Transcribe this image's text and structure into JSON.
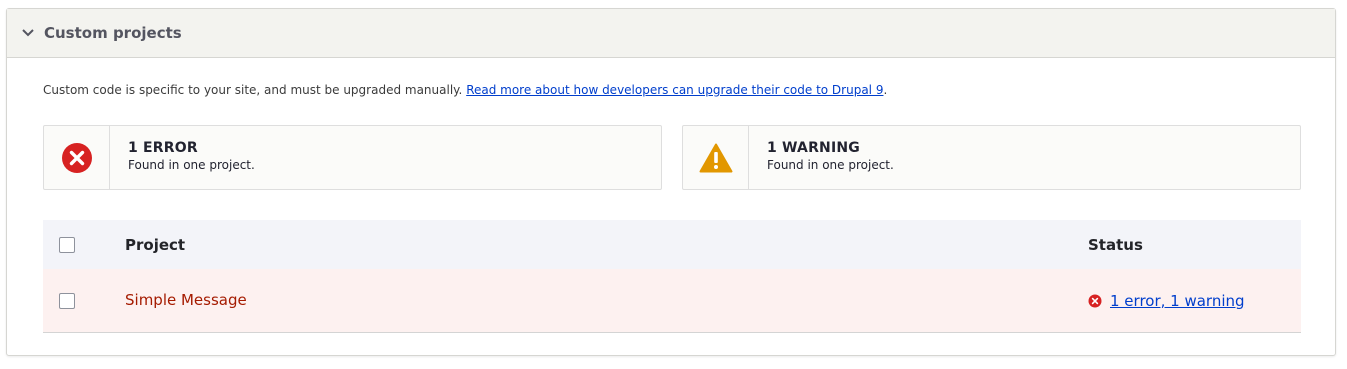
{
  "panel": {
    "title": "Custom projects"
  },
  "intro": {
    "text": "Custom code is specific to your site, and must be upgraded manually. ",
    "link_text": "Read more about how developers can upgrade their code to Drupal 9",
    "trailing": "."
  },
  "summary": {
    "error": {
      "icon": "error-circle-icon",
      "count": "1 ERROR",
      "desc": "Found in one project."
    },
    "warning": {
      "icon": "warning-triangle-icon",
      "count": "1 WARNING",
      "desc": "Found in one project."
    }
  },
  "table": {
    "headers": {
      "project": "Project",
      "status": "Status"
    },
    "rows": [
      {
        "project": "Simple Message",
        "status": "1 error, 1 warning"
      }
    ]
  },
  "colors": {
    "error": "#d72222",
    "warning": "#e29700",
    "link": "#003ecc",
    "project_error_text": "#a51b00"
  }
}
